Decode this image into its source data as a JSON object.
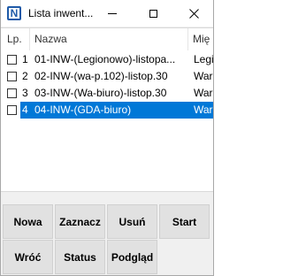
{
  "window": {
    "title": "Lista inwent..."
  },
  "titlebar": {
    "icon_letter": "N"
  },
  "table": {
    "columns": [
      "Lp.",
      "Nazwa",
      "Mię"
    ],
    "rows": [
      {
        "lp": "1",
        "name": "01-INW-(Legionowo)-listopa...",
        "place": "Legio",
        "checked": false,
        "selected": false
      },
      {
        "lp": "2",
        "name": "02-INW-(wa-p.102)-listop.30",
        "place": "War",
        "checked": false,
        "selected": false
      },
      {
        "lp": "3",
        "name": "03-INW-(Wa-biuro)-listop.30",
        "place": "War",
        "checked": false,
        "selected": false
      },
      {
        "lp": "4",
        "name": "04-INW-(GDA-biuro)",
        "place": "War",
        "checked": false,
        "selected": true
      }
    ]
  },
  "buttons": {
    "row1": [
      "Nowa",
      "Zaznacz",
      "Usuń",
      "Start"
    ],
    "row2": [
      "Wróć",
      "Status",
      "Podgląd"
    ]
  }
}
